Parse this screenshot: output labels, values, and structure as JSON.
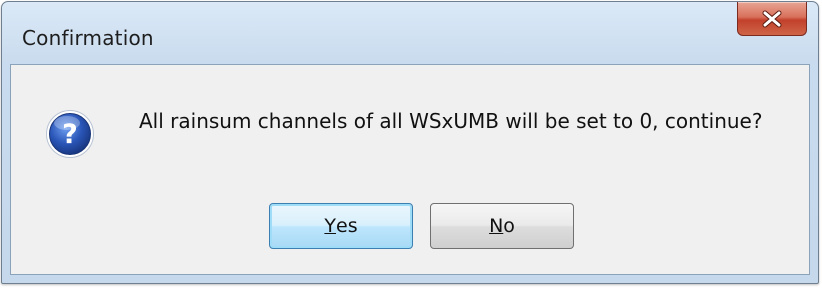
{
  "window": {
    "title": "Confirmation"
  },
  "dialog": {
    "icon": "question-icon",
    "message": "All rainsum channels of all WSxUMB will be set to 0, continue?"
  },
  "buttons": {
    "yes": {
      "accel": "Y",
      "rest": "es"
    },
    "no": {
      "accel": "N",
      "rest": "o"
    }
  },
  "colors": {
    "close_button": "#c7432c",
    "default_button_border": "#3c7fb1",
    "question_icon": "#2a56b8"
  }
}
